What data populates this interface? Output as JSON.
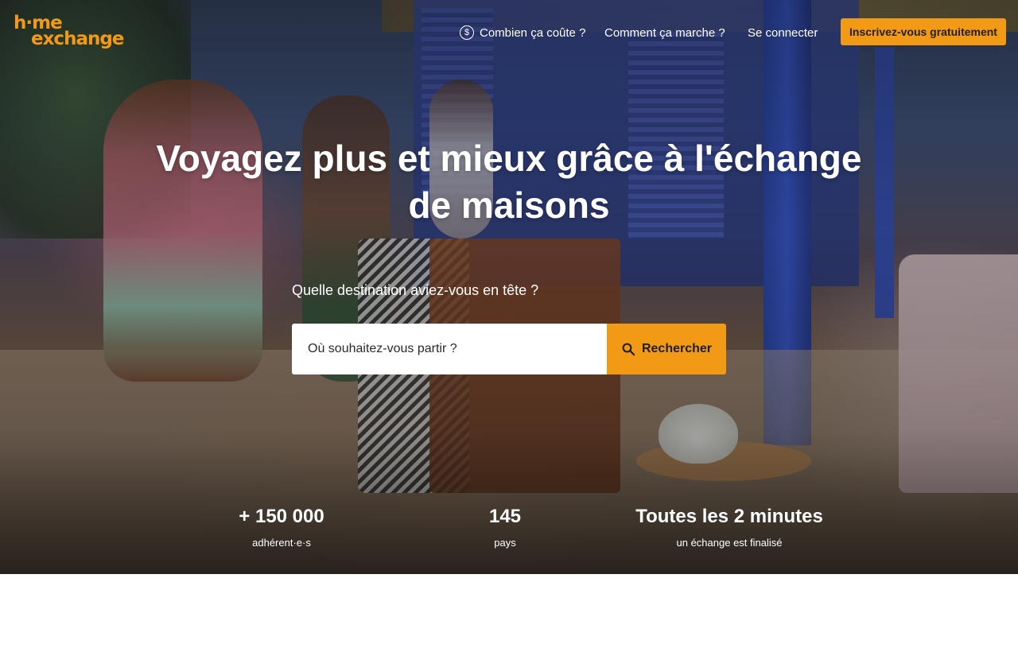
{
  "header": {
    "logo_line1": "h·me",
    "logo_line2": "exchange",
    "nav_price": "Combien ça coûte ?",
    "nav_how": "Comment ça marche ?",
    "nav_login": "Se connecter",
    "signup_label": "Inscrivez-vous gratuitement",
    "price_icon": "dollar-circle-icon"
  },
  "hero": {
    "headline_line1": "Voyagez plus et mieux grâce à l'échange",
    "headline_line2": "de maisons",
    "question": "Quelle destination aviez-vous en tête ?",
    "search_placeholder": "Où souhaitez-vous partir ?",
    "search_button": "Rechercher",
    "search_icon": "search-icon"
  },
  "stats": [
    {
      "value": "+ 150 000",
      "label": "adhérent·e·s"
    },
    {
      "value": "145",
      "label": "pays"
    },
    {
      "value": "Toutes les 2 minutes",
      "label": "un échange est finalisé"
    }
  ],
  "colors": {
    "accent": "#f29a16",
    "text_dark": "#1e1e1e",
    "white": "#ffffff"
  }
}
